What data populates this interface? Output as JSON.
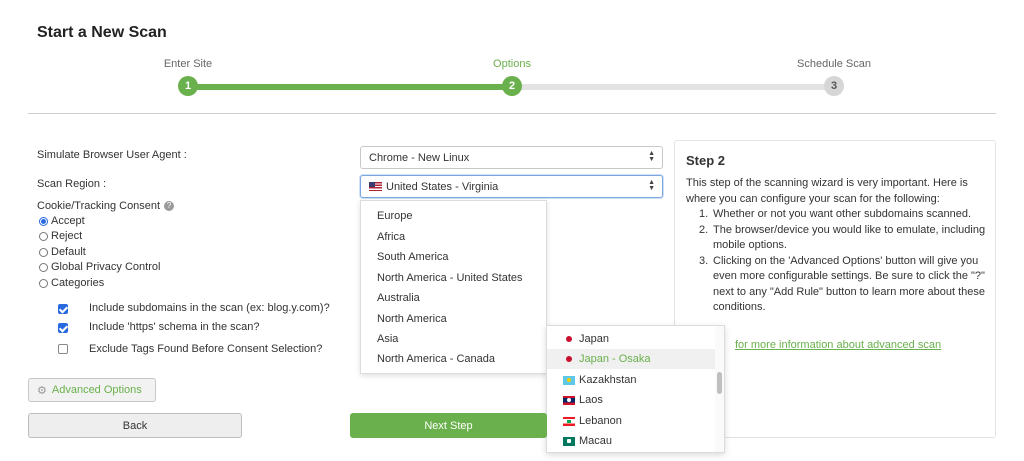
{
  "page": {
    "title": "Start a New Scan"
  },
  "stepper": {
    "steps": [
      {
        "label": "Enter Site",
        "number": "1",
        "state": "done"
      },
      {
        "label": "Options",
        "number": "2",
        "state": "active"
      },
      {
        "label": "Schedule Scan",
        "number": "3",
        "state": "todo"
      }
    ]
  },
  "form": {
    "user_agent_label": "Simulate Browser User Agent :",
    "user_agent_value": "Chrome - New Linux",
    "region_label": "Scan Region :",
    "region_value": "United States - Virginia",
    "consent_label": "Cookie/Tracking Consent",
    "consent_options": [
      "Accept",
      "Reject",
      "Default",
      "Global Privacy Control",
      "Categories"
    ],
    "consent_selected": "Accept",
    "checkboxes": [
      {
        "label": "Include subdomains in the scan (ex: blog.y.com)?",
        "checked": true
      },
      {
        "label": "Include 'https' schema in the scan?",
        "checked": true
      },
      {
        "label": "Exclude Tags Found Before Consent Selection?",
        "checked": false
      }
    ]
  },
  "region_menu": {
    "items": [
      "Europe",
      "Africa",
      "South America",
      "North America - United States",
      "Australia",
      "North America",
      "Asia",
      "North America - Canada"
    ]
  },
  "country_menu": {
    "items": [
      {
        "label": "Japan",
        "flag": "japan-flag-icon"
      },
      {
        "label": "Japan - Osaka",
        "flag": "japan-flag-icon",
        "hovered": true
      },
      {
        "label": "Kazakhstan",
        "flag": "kazakhstan-flag-icon"
      },
      {
        "label": "Laos",
        "flag": "laos-flag-icon"
      },
      {
        "label": "Lebanon",
        "flag": "lebanon-flag-icon"
      },
      {
        "label": "Macau",
        "flag": "macau-flag-icon"
      }
    ]
  },
  "info": {
    "title": "Step 2",
    "intro": "This step of the scanning wizard is very important. Here is where you can configure your scan for the following:",
    "list": [
      "Whether or not you want other subdomains scanned.",
      "The browser/device you would like to emulate, including mobile options.",
      "Clicking on the 'Advanced Options' button will give you even more configurable settings. Be sure to click the \"?\" next to any \"Add Rule\" button to learn more about these conditions."
    ],
    "link_text": "for more information about advanced scan"
  },
  "buttons": {
    "advanced": "Advanced Options",
    "back": "Back",
    "next": "Next Step"
  },
  "colors": {
    "accent": "#6ab04c",
    "track_inactive": "#e3e3e3"
  },
  "icons": {
    "help": "question-circle-icon",
    "gear": "gear-icon",
    "select": "select-arrows-icon"
  }
}
